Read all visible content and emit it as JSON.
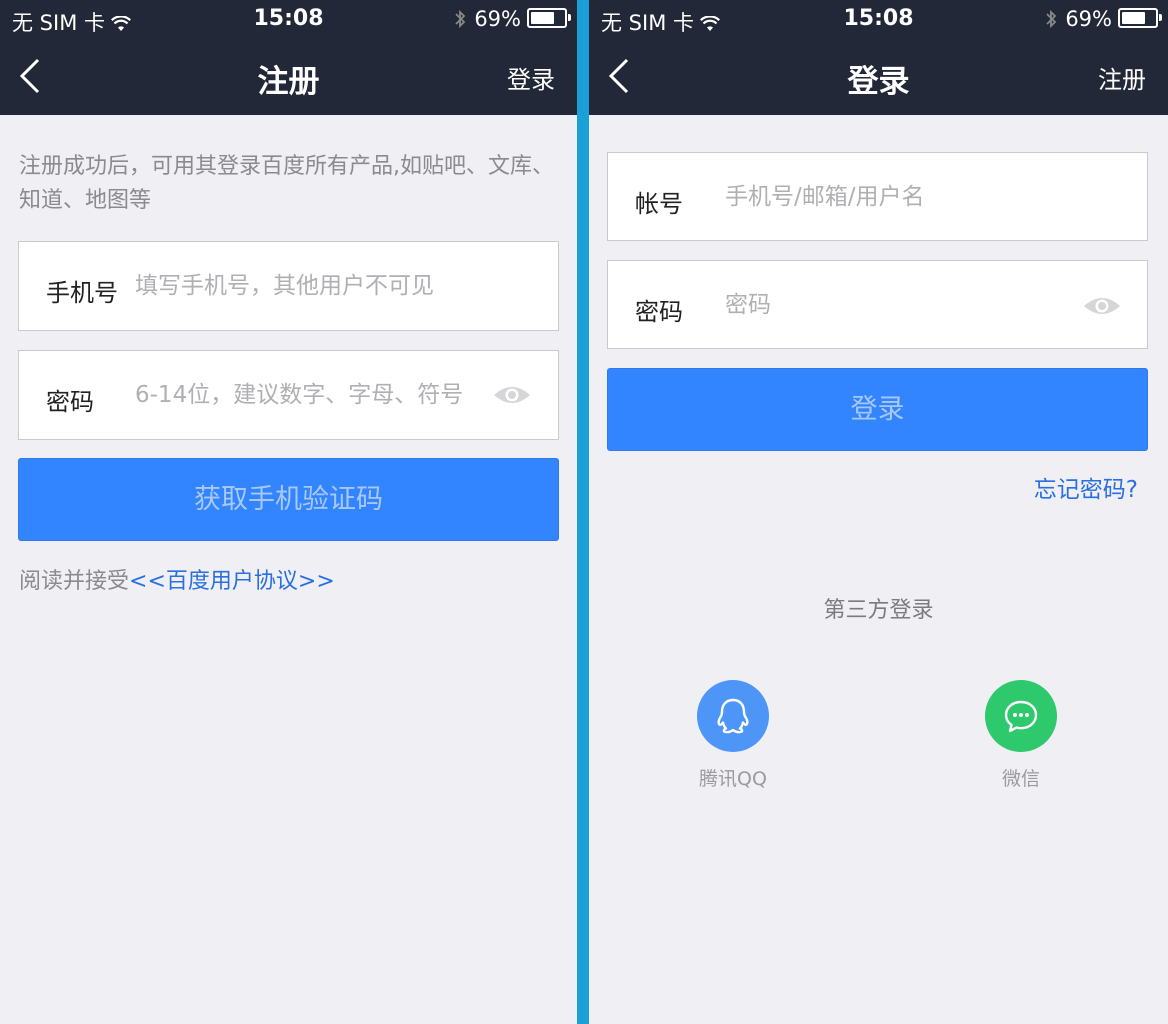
{
  "status": {
    "carrier": "无 SIM 卡",
    "time": "15:08",
    "battery": "69%"
  },
  "register": {
    "title": "注册",
    "nav_action": "登录",
    "intro": "注册成功后，可用其登录百度所有产品,如贴吧、文库、知道、地图等",
    "phone_label": "手机号",
    "phone_placeholder": "填写手机号，其他用户不可见",
    "password_label": "密码",
    "password_placeholder": "6-14位，建议数字、字母、符号",
    "submit_label": "获取手机验证码",
    "agreement_prefix": "阅读并接受",
    "agreement_link": "<<百度用户协议>>"
  },
  "login": {
    "title": "登录",
    "nav_action": "注册",
    "account_label": "帐号",
    "account_placeholder": "手机号/邮箱/用户名",
    "password_label": "密码",
    "password_placeholder": "密码",
    "submit_label": "登录",
    "forgot_label": "忘记密码?",
    "third_party_title": "第三方登录",
    "providers": [
      {
        "name": "腾讯QQ",
        "icon": "qq-icon",
        "color": "#4d96f7"
      },
      {
        "name": "微信",
        "icon": "wechat-icon",
        "color": "#2ec96c"
      }
    ]
  },
  "colors": {
    "navbar": "#222838",
    "primary": "#3385ff",
    "link": "#2a6fe0",
    "background": "#efeff4",
    "divider": "#1aa0d6"
  }
}
